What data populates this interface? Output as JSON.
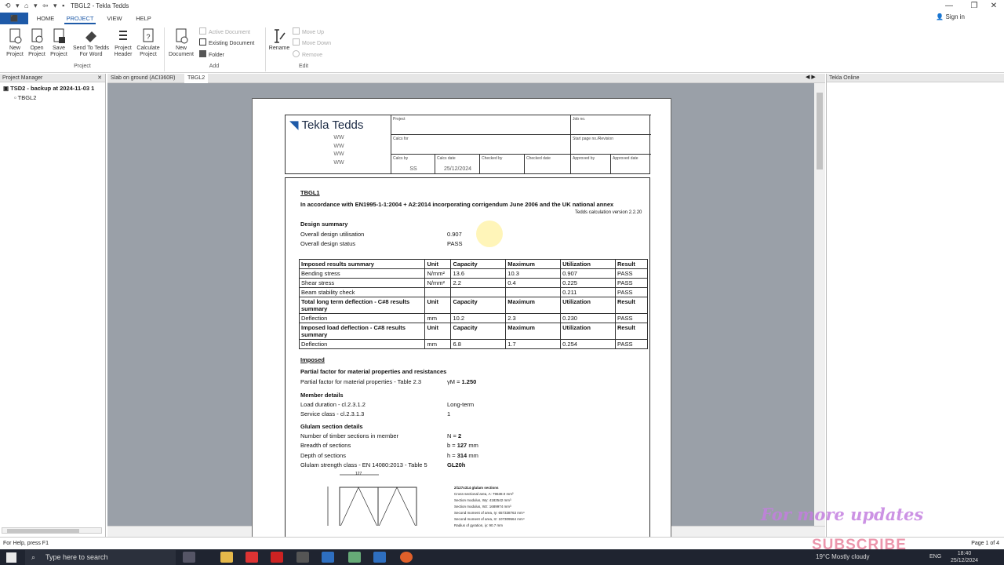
{
  "window": {
    "title": "TBGL2 - Tekla Tedds",
    "minimize": "—",
    "restore": "❐",
    "close": "✕"
  },
  "ribbon_tabs": {
    "file": "⬛",
    "home": "HOME",
    "project": "PROJECT",
    "view": "VIEW",
    "help": "HELP"
  },
  "signin": "Sign in",
  "ribbon": {
    "project_group": "Project",
    "add_group": "Add",
    "edit_group": "Edit",
    "new_project": "New\nProject",
    "open_project": "Open\nProject",
    "save_project": "Save\nProject",
    "send_to_word": "Send To Tedds\nFor Word",
    "project_header": "Project\nHeader",
    "calculate_project": "Calculate\nProject",
    "new_document": "New\nDocument",
    "active_document": "Active Document",
    "existing_document": "Existing Document",
    "folder": "Folder",
    "rename": "Rename",
    "move_up": "Move Up",
    "move_down": "Move Down",
    "remove": "Remove"
  },
  "project_manager": {
    "title": "Project Manager",
    "root": "TSD2 - backup at 2024-11-03 1",
    "child": "TBGL2"
  },
  "doc_tabs": [
    "Slab on ground (ACI360R)",
    "TBGL2"
  ],
  "tekla_online": "Tekla Online",
  "page": {
    "logo": "Tekla Tedds",
    "ww": [
      "WW",
      "WW",
      "WW",
      "WW"
    ],
    "project_label": "Project",
    "job_label": "Job no.",
    "calcs_for_label": "Calcs for",
    "start_page_label": "Start page no./Revision",
    "calcs_by_label": "Calcs by",
    "calcs_by": "SS",
    "calcs_date_label": "Calcs date",
    "calcs_date": "25/12/2024",
    "checked_by_label": "Checked by",
    "checked_date_label": "Checked date",
    "approved_by_label": "Approved by",
    "approved_date_label": "Approved date",
    "doc_title": "TBGL1",
    "standard": "In accordance with EN1995-1-1:2004 + A2:2014 incorporating corrigendum June 2006 and the UK national annex",
    "version": "Tedds calculation version 2.2.20",
    "design_summary": "Design summary",
    "util_label": "Overall design utilisation",
    "util_value": "0.907",
    "status_label": "Overall design status",
    "status_value": "PASS",
    "table": [
      [
        "Imposed results summary",
        "Unit",
        "Capacity",
        "Maximum",
        "Utilization",
        "Result"
      ],
      [
        "Bending stress",
        "N/mm²",
        "13.6",
        "10.3",
        "0.907",
        "PASS"
      ],
      [
        "Shear stress",
        "N/mm²",
        "2.2",
        "0.4",
        "0.225",
        "PASS"
      ],
      [
        "Beam stability check",
        "",
        "",
        "",
        "0.211",
        "PASS"
      ],
      [
        "Total long term deflection - C#8 results summary",
        "Unit",
        "Capacity",
        "Maximum",
        "Utilization",
        "Result"
      ],
      [
        "Deflection",
        "mm",
        "10.2",
        "2.3",
        "0.230",
        "PASS"
      ],
      [
        "Imposed load deflection - C#8 results summary",
        "Unit",
        "Capacity",
        "Maximum",
        "Utilization",
        "Result"
      ],
      [
        "Deflection",
        "mm",
        "6.8",
        "1.7",
        "0.254",
        "PASS"
      ]
    ],
    "imposed": "Imposed",
    "partial_factors": "Partial factor for material properties and resistances",
    "pf_label": "Partial factor for material properties - Table 2.3",
    "pf_sym": "γM = ",
    "pf_value": "1.250",
    "member_details": "Member details",
    "load_duration_label": "Load duration - cl.2.3.1.2",
    "load_duration": "Long-term",
    "service_class_label": "Service class - cl.2.3.1.3",
    "service_class": "1",
    "glulam_details": "Glulam section details",
    "num_sections_label": "Number of timber sections in member",
    "num_sections_sym": "N = ",
    "num_sections": "2",
    "breadth_label": "Breadth of sections",
    "breadth_sym": "b = ",
    "breadth": "127",
    "breadth_unit": " mm",
    "depth_label": "Depth of sections",
    "depth_sym": "h = ",
    "depth": "314",
    "depth_unit": " mm",
    "strength_label": "Glulam strength class - EN 14080:2013 - Table 5",
    "strength": "GL20h",
    "dim127": "127",
    "sec_title": "2/127x314 glulam sections",
    "sec_lines": [
      "Cross-sectional area, A: 79638.0 mm²",
      "Section modulus, Wy: 4182542 mm³",
      "Section modulus, Wz: 1689974 mm³",
      "Second moment of area, Iy: 657338763 mm⁴",
      "Second moment of area, Iz: 107309564 mm⁴",
      "Radius of gyration, iy: 90.7 mm"
    ]
  },
  "statusbar": {
    "help": "For Help, press F1",
    "page": "Page 1 of 4"
  },
  "taskbar": {
    "search": "Type here to search",
    "weather": "19°C  Mostly cloudy",
    "lang": "ENG",
    "time": "18:40",
    "date": "25/12/2024"
  },
  "overlay": {
    "updates": "For more updates",
    "subscribe": "SUBSCRIBE"
  }
}
